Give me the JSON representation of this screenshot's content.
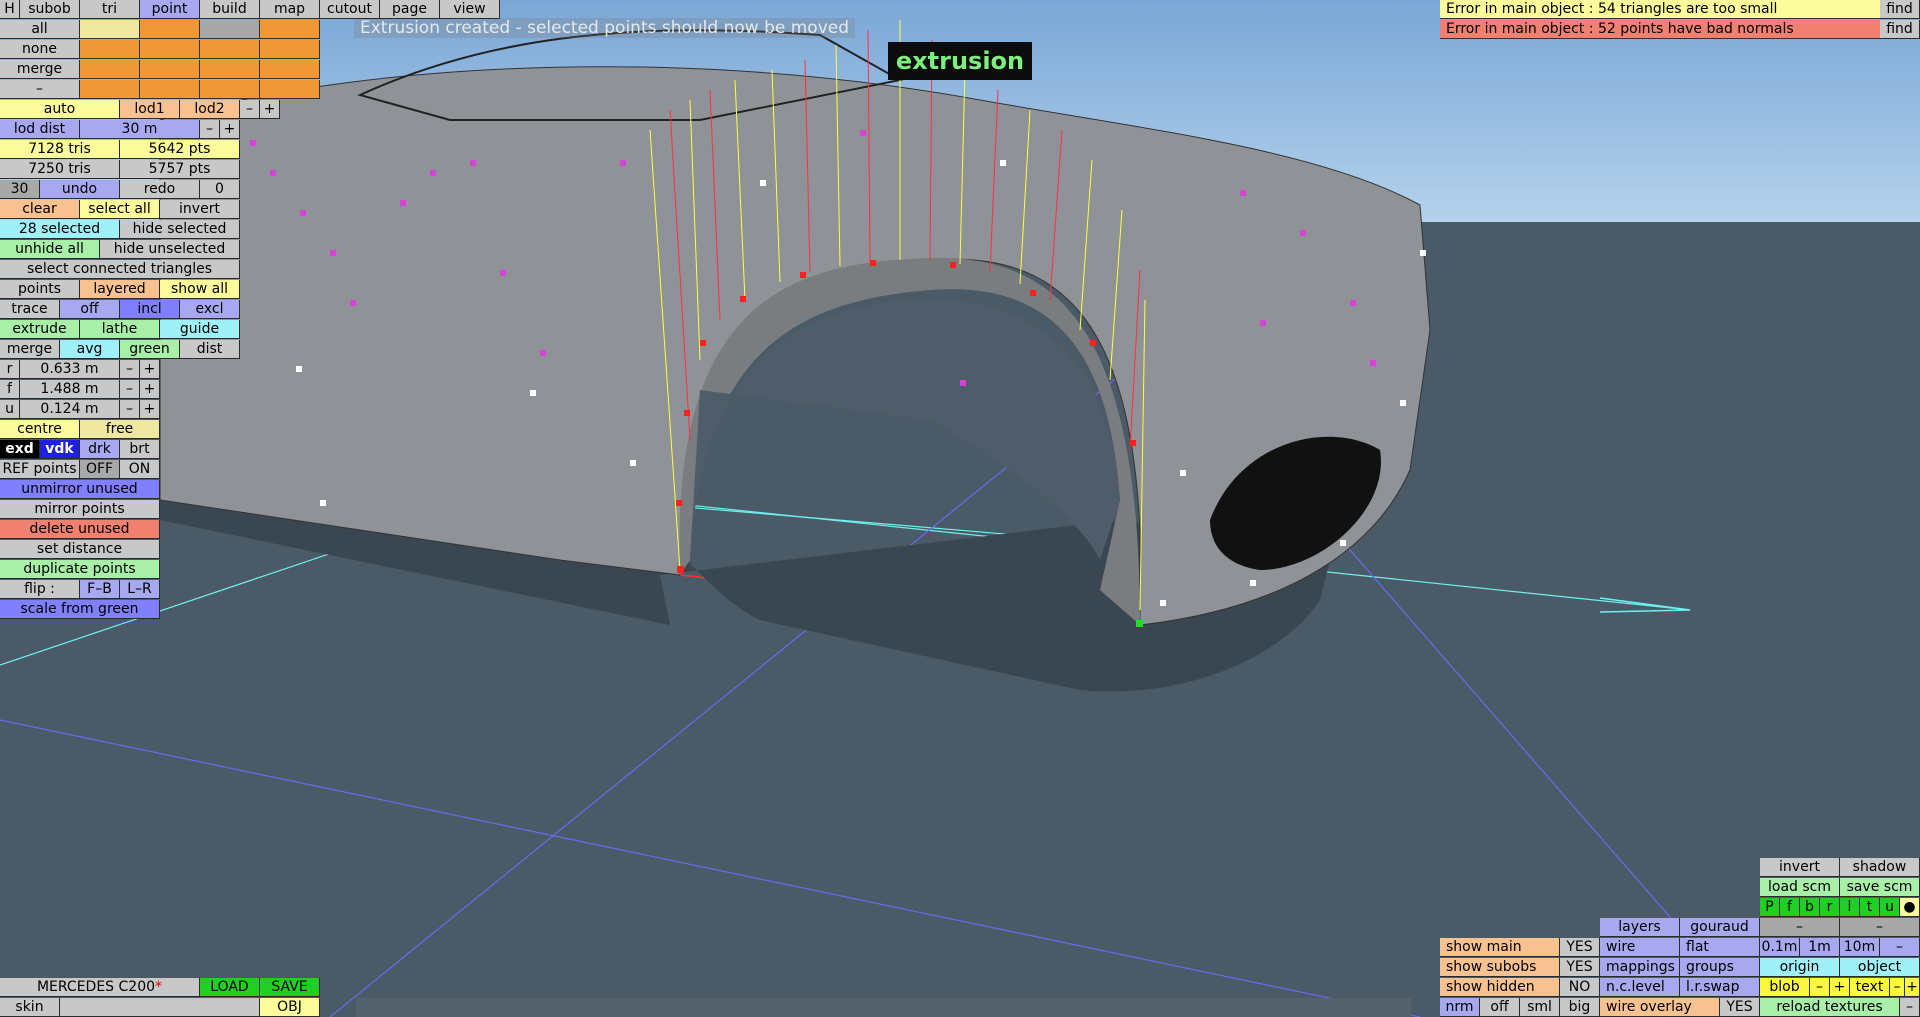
{
  "top_tabs": [
    {
      "label": "H",
      "active": false
    },
    {
      "label": "subob",
      "active": false
    },
    {
      "label": "tri",
      "active": false
    },
    {
      "label": "point",
      "active": true
    },
    {
      "label": "build",
      "active": false
    },
    {
      "label": "map",
      "active": false
    },
    {
      "label": "cutout",
      "active": false
    },
    {
      "label": "page",
      "active": false
    },
    {
      "label": "view",
      "active": false
    }
  ],
  "selection_rows": {
    "all": "all",
    "none": "none",
    "merge": "merge",
    "dash": "–"
  },
  "lod": {
    "auto": "auto",
    "lod1": "lod1",
    "lod2": "lod2",
    "minus": "–",
    "plus": "+",
    "lod_dist_label": "lod dist",
    "lod_dist_value": "30 m"
  },
  "stats": {
    "tris1": "7128 tris",
    "pts1": "5642 pts",
    "tris2": "7250 tris",
    "pts2": "5757 pts"
  },
  "undo_row": {
    "count": "30",
    "undo": "undo",
    "redo": "redo",
    "redo_count": "0"
  },
  "select_row": {
    "clear": "clear",
    "select_all": "select all",
    "invert": "invert"
  },
  "selected_row": {
    "selected": "28 selected",
    "hide_selected": "hide selected"
  },
  "unhide_row": {
    "unhide_all": "unhide all",
    "hide_unselected": "hide unselected"
  },
  "connected": "select connected triangles",
  "points_row": {
    "points": "points",
    "layered": "layered",
    "show_all": "show all"
  },
  "trace_row": {
    "trace": "trace",
    "off": "off",
    "incl": "incl",
    "excl": "excl"
  },
  "extrude_row": {
    "extrude": "extrude",
    "lathe": "lathe",
    "guide": "guide"
  },
  "merge_row": {
    "merge": "merge",
    "avg": "avg",
    "green": "green",
    "dist": "dist"
  },
  "dims": [
    {
      "axis": "r",
      "value": "0.633 m",
      "minus": "–",
      "plus": "+"
    },
    {
      "axis": "f",
      "value": "1.488 m",
      "minus": "–",
      "plus": "+"
    },
    {
      "axis": "u",
      "value": "0.124 m",
      "minus": "–",
      "plus": "+"
    }
  ],
  "centre_row": {
    "centre": "centre",
    "free": "free"
  },
  "display_row": {
    "exd": "exd",
    "vdk": "vdk",
    "drk": "drk",
    "brt": "brt"
  },
  "ref_row": {
    "ref": "REF points",
    "off": "OFF",
    "on": "ON"
  },
  "actions": {
    "unmirror": "unmirror unused",
    "mirror": "mirror points",
    "delete": "delete unused",
    "set_distance": "set distance",
    "duplicate": "duplicate points",
    "flip": "flip :",
    "fb": "F–B",
    "lr": "L–R",
    "scale": "scale from green"
  },
  "status_message": "Extrusion created - selected points should now be moved",
  "mode_label": "extrusion",
  "errors": [
    {
      "text": "Error in main object : 54 triangles are too small",
      "find": "find"
    },
    {
      "text": "Error in main object : 52 points have bad normals",
      "find": "find"
    }
  ],
  "bottom_left": {
    "model_name": "MERCEDES C200",
    "modified_mark": "*",
    "load": "LOAD",
    "save": "SAVE",
    "skin": "skin",
    "obj": "OBJ"
  },
  "bottom_right": {
    "invert": "invert",
    "shadow": "shadow",
    "load_scm": "load scm",
    "save_scm": "save scm",
    "views": [
      "P",
      "f",
      "b",
      "r",
      "l",
      "t",
      "u",
      "●"
    ],
    "dash1": "–",
    "dash2": "–",
    "layers": "layers",
    "gouraud": "gouraud",
    "show_main": "show main",
    "show_main_v": "YES",
    "show_subobs": "show subobs",
    "show_subobs_v": "YES",
    "show_hidden": "show hidden",
    "show_hidden_v": "NO",
    "wire": "wire",
    "flat": "flat",
    "mappings": "mappings",
    "groups": "groups",
    "nc_level": "n.c.level",
    "lr_swap": "l.r.swap",
    "grid": [
      "0.1m",
      "1m",
      "10m",
      "–"
    ],
    "origin": "origin",
    "object": "object",
    "blob": "blob",
    "blob_minus": "–",
    "blob_plus": "+",
    "text": "text",
    "text_minus": "–",
    "text_plus": "+",
    "nrm": "nrm",
    "off": "off",
    "sml": "sml",
    "big": "big",
    "wire_overlay": "wire overlay",
    "wire_overlay_v": "YES",
    "reload": "reload textures",
    "reload_minus": "–"
  }
}
